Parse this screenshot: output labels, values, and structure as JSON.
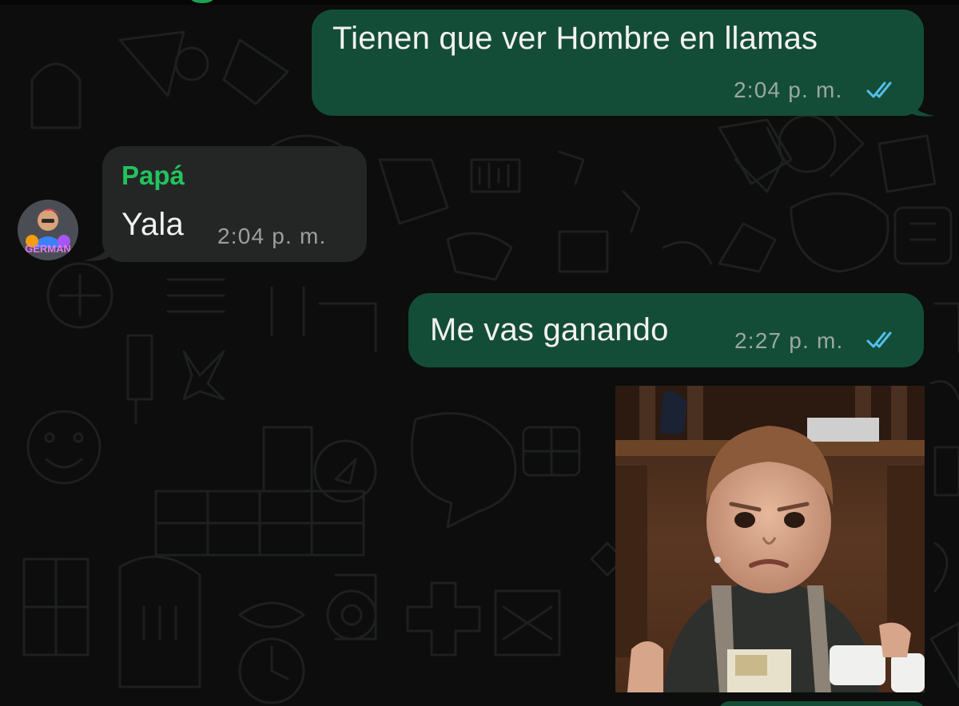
{
  "messages": [
    {
      "direction": "outgoing",
      "text": "Tienen que ver Hombre en llamas",
      "time": "2:04 p. m.",
      "status": "read-double-check"
    },
    {
      "direction": "incoming",
      "sender": "Papá",
      "text": "Yala",
      "time": "2:04 p. m.",
      "avatar_text": "GERMAN"
    },
    {
      "direction": "outgoing",
      "text": "Me vas ganando",
      "time": "2:27 p. m.",
      "status": "read-double-check"
    },
    {
      "direction": "outgoing",
      "type": "image",
      "image_description": "toddler-frowning-photo"
    }
  ],
  "colors": {
    "outgoing_bubble": "#144d37",
    "incoming_bubble": "#242626",
    "sender_name": "#22c35e",
    "read_ticks": "#53bdeb",
    "background": "#0c0d0c"
  },
  "icons": [
    "double-check-icon",
    "avatar-icon"
  ]
}
